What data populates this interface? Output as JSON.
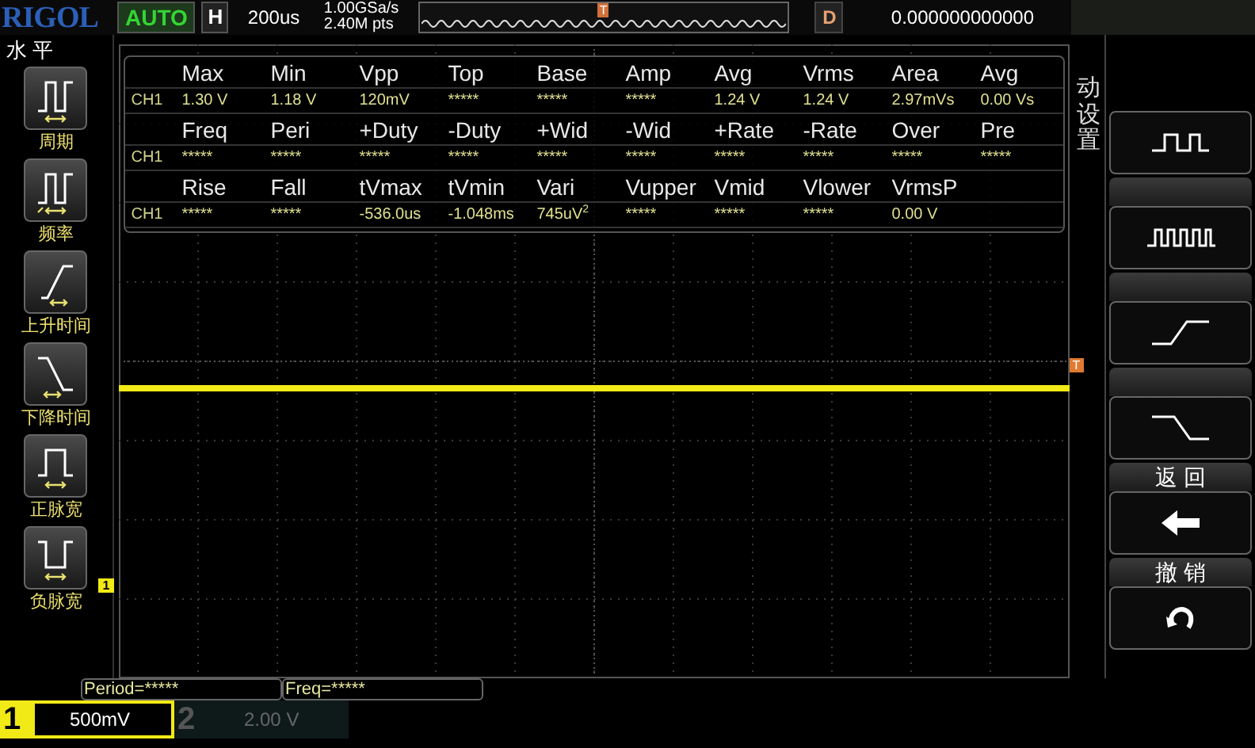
{
  "top_bar": {
    "logo": "RIGOL",
    "run_state": "AUTO",
    "timebase_label": "H",
    "timebase": "200us",
    "sample_rate": "1.00GSa/s",
    "memory_depth": "2.40M pts",
    "trigger_marker": "T",
    "delay_label": "D",
    "delay": "0.000000000000"
  },
  "left_menu": {
    "title": "水 平",
    "items": [
      {
        "kind": "period",
        "label": "周期"
      },
      {
        "kind": "frequency",
        "label": "频率"
      },
      {
        "kind": "rise",
        "label": "上升时间"
      },
      {
        "kind": "fall",
        "label": "下降时间"
      },
      {
        "kind": "positive-width",
        "label": "正脉宽"
      },
      {
        "kind": "negative-width",
        "label": "负脉宽"
      }
    ]
  },
  "measurements": {
    "rows": [
      {
        "headers": [
          "Max",
          "Min",
          "Vpp",
          "Top",
          "Base",
          "Amp",
          "Avg",
          "Vrms",
          "Area",
          "Avg"
        ],
        "channel": "CH1",
        "values": [
          "1.30 V",
          "1.18 V",
          "120mV",
          "*****",
          "*****",
          "*****",
          "1.24 V",
          "1.24 V",
          "2.97mVs",
          "0.00 Vs"
        ]
      },
      {
        "headers": [
          "Freq",
          "Peri",
          "+Duty",
          "-Duty",
          "+Wid",
          "-Wid",
          "+Rate",
          "-Rate",
          "Over",
          "Pre"
        ],
        "channel": "CH1",
        "values": [
          "*****",
          "*****",
          "*****",
          "*****",
          "*****",
          "*****",
          "*****",
          "*****",
          "*****",
          "*****"
        ]
      },
      {
        "headers": [
          "Rise",
          "Fall",
          "tVmax",
          "tVmin",
          "Vari",
          "Vupper",
          "Vmid",
          "Vlower",
          "VrmsP"
        ],
        "channel": "CH1",
        "values": [
          "*****",
          "*****",
          "-536.0us",
          "-1.048ms",
          {
            "text": "745uV",
            "superscript": "2"
          },
          "*****",
          "*****",
          "*****",
          "0.00 V"
        ]
      }
    ]
  },
  "trace": {
    "channel_marker": "1",
    "trigger_marker": "T"
  },
  "right_menu": {
    "side_label": "动设置",
    "items": [
      {
        "kind": "square-wave"
      },
      {
        "kind": "pulse-train"
      },
      {
        "kind": "rise"
      },
      {
        "kind": "fall"
      },
      {
        "kind": "back",
        "header": "返 回"
      },
      {
        "kind": "undo",
        "header": "撤 销"
      }
    ]
  },
  "counters": [
    "Period=*****",
    "Freq=*****"
  ],
  "channels": [
    {
      "number": "1",
      "scale": "500mV",
      "active": true
    },
    {
      "number": "2",
      "scale": "2.00 V",
      "active": false
    }
  ]
}
